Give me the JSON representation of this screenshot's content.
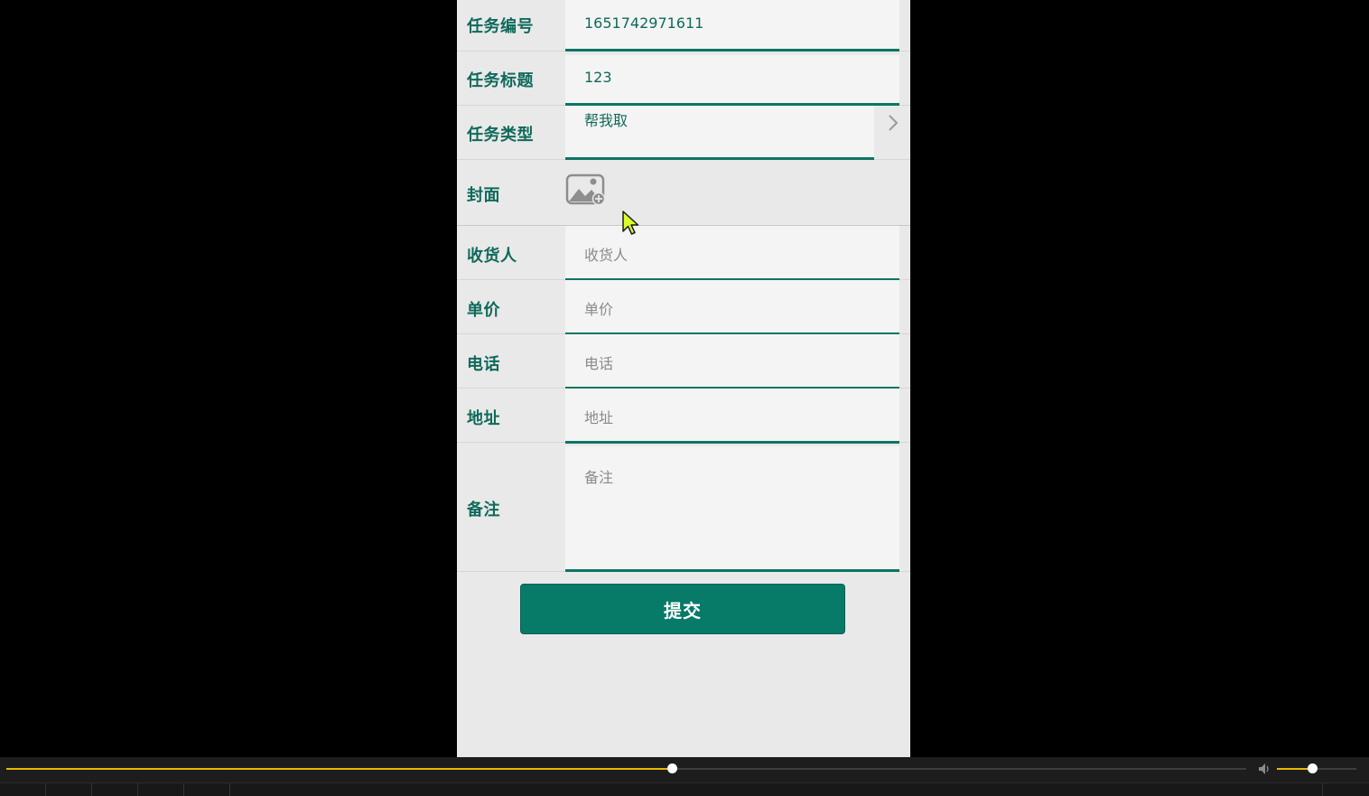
{
  "form": {
    "task_id": {
      "label": "任务编号",
      "value": "1651742971611"
    },
    "task_title": {
      "label": "任务标题",
      "value": "123"
    },
    "task_type": {
      "label": "任务类型",
      "value": "帮我取"
    },
    "cover": {
      "label": "封面"
    },
    "receiver": {
      "label": "收货人",
      "placeholder": "收货人"
    },
    "unit_price": {
      "label": "单价",
      "placeholder": "单价"
    },
    "phone": {
      "label": "电话",
      "placeholder": "电话"
    },
    "address": {
      "label": "地址",
      "placeholder": "地址"
    },
    "remark": {
      "label": "备注",
      "placeholder": "备注"
    },
    "submit_label": "提交"
  },
  "player": {
    "progress": 0.537,
    "volume": 0.44,
    "accent_color": "#e6b800"
  },
  "colors": {
    "label_green": "#0f6a5b",
    "button_green": "#077a68"
  }
}
